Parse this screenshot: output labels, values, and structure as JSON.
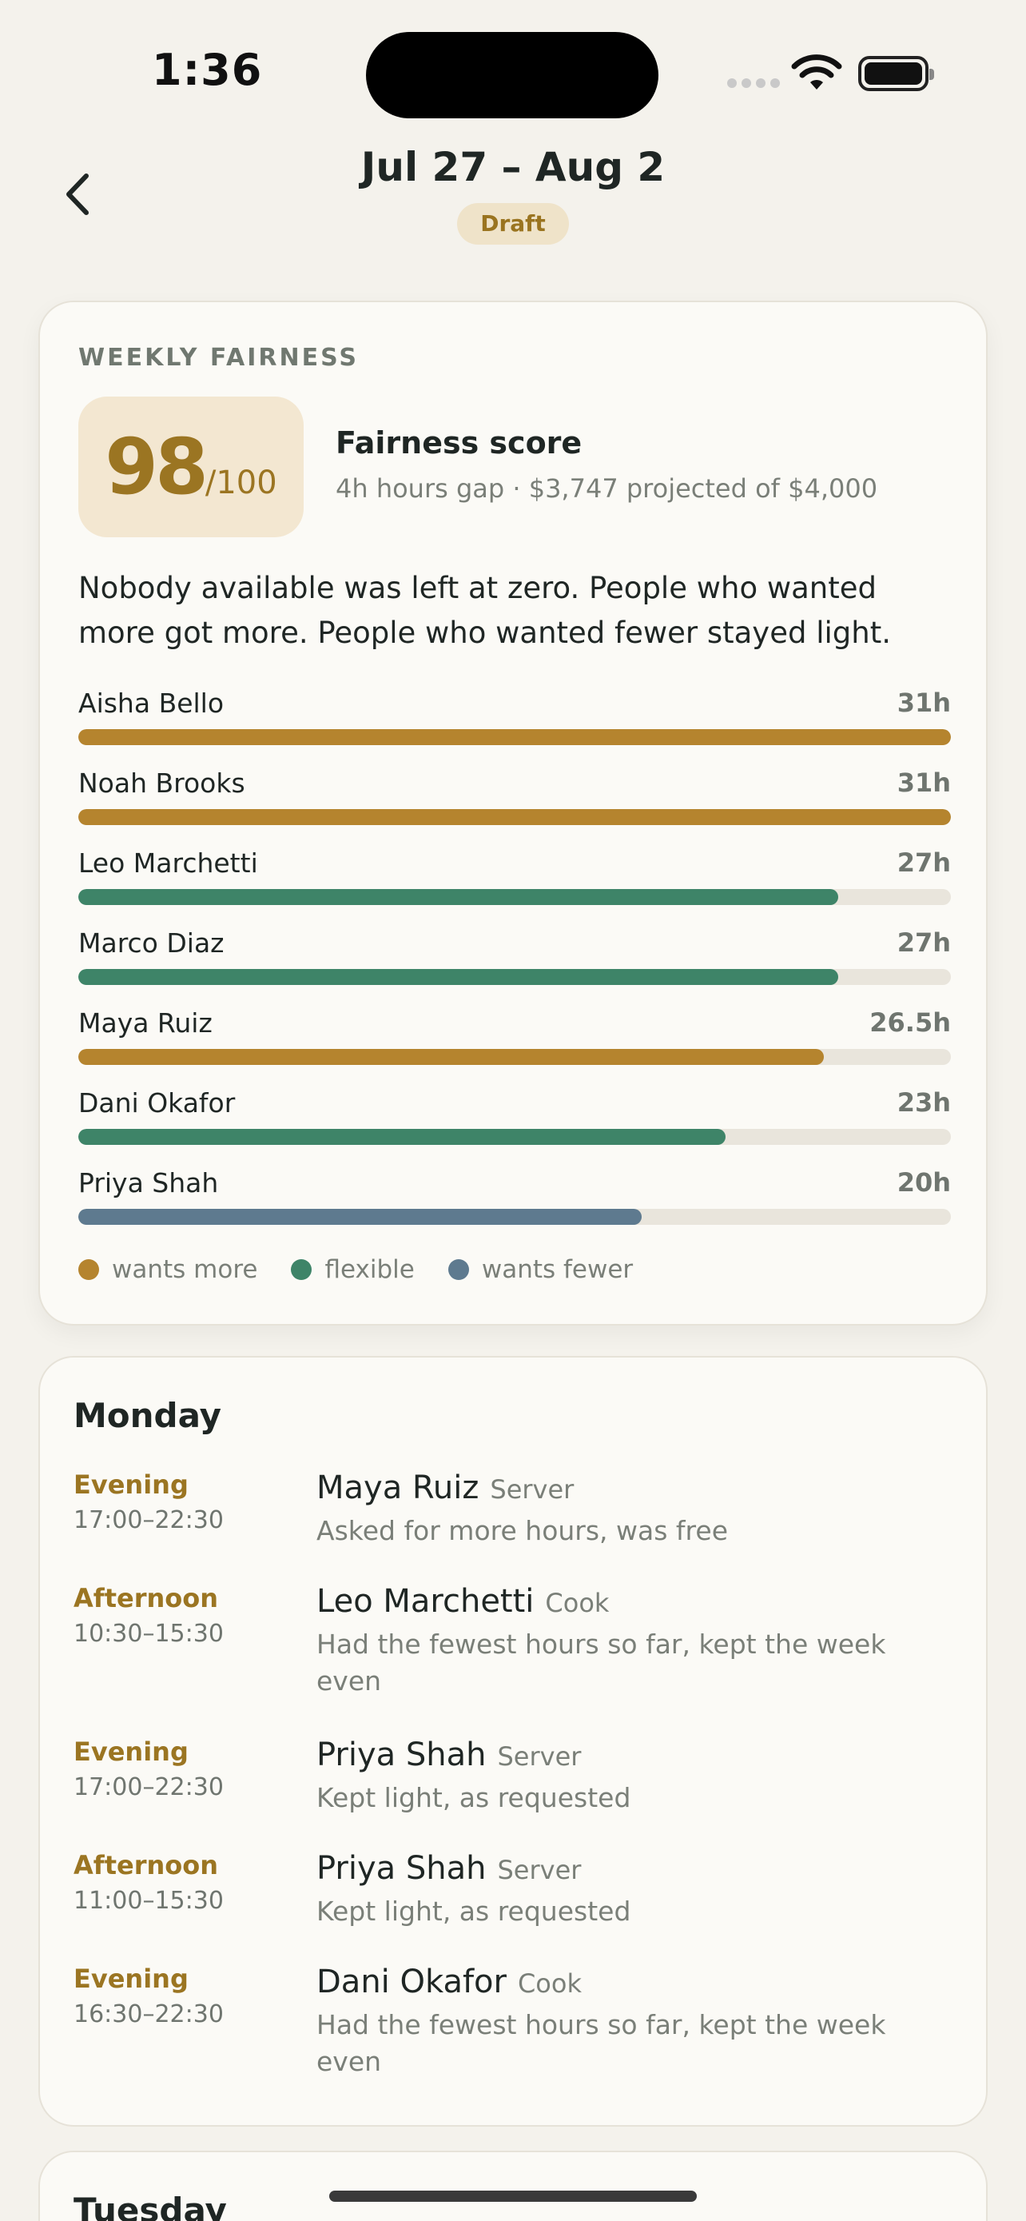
{
  "status_bar": {
    "time": "1:36"
  },
  "header": {
    "title": "Jul 27 – Aug 2",
    "badge": "Draft"
  },
  "fairness": {
    "section_label": "WEEKLY FAIRNESS",
    "score": "98",
    "score_denominator": "/100",
    "score_title": "Fairness score",
    "score_subtitle": "4h hours gap · $3,747 projected of $4,000",
    "summary": "Nobody available was left at zero. People who wanted more got more. People who wanted fewer stayed light.",
    "max_hours": 31,
    "people": [
      {
        "name": "Aisha Bello",
        "hours_label": "31h",
        "hours": 31,
        "preference": "wants_more"
      },
      {
        "name": "Noah Brooks",
        "hours_label": "31h",
        "hours": 31,
        "preference": "wants_more"
      },
      {
        "name": "Leo Marchetti",
        "hours_label": "27h",
        "hours": 27,
        "preference": "flexible"
      },
      {
        "name": "Marco Diaz",
        "hours_label": "27h",
        "hours": 27,
        "preference": "flexible"
      },
      {
        "name": "Maya Ruiz",
        "hours_label": "26.5h",
        "hours": 26.5,
        "preference": "wants_more"
      },
      {
        "name": "Dani Okafor",
        "hours_label": "23h",
        "hours": 23,
        "preference": "flexible"
      },
      {
        "name": "Priya Shah",
        "hours_label": "20h",
        "hours": 20,
        "preference": "wants_fewer"
      }
    ],
    "legend": [
      {
        "key": "wants_more",
        "label": "wants more",
        "color": "#b5842e"
      },
      {
        "key": "flexible",
        "label": "flexible",
        "color": "#3e8468"
      },
      {
        "key": "wants_fewer",
        "label": "wants fewer",
        "color": "#5e7a8f"
      }
    ]
  },
  "schedule": {
    "monday": {
      "title": "Monday",
      "shifts": [
        {
          "period": "Evening",
          "time": "17:00–22:30",
          "name": "Maya Ruiz",
          "role": "Server",
          "note": "Asked for more hours, was free"
        },
        {
          "period": "Afternoon",
          "time": "10:30–15:30",
          "name": "Leo Marchetti",
          "role": "Cook",
          "note": "Had the fewest hours so far, kept the week even"
        },
        {
          "period": "Evening",
          "time": "17:00–22:30",
          "name": "Priya Shah",
          "role": "Server",
          "note": "Kept light, as requested"
        },
        {
          "period": "Afternoon",
          "time": "11:00–15:30",
          "name": "Priya Shah",
          "role": "Server",
          "note": "Kept light, as requested"
        },
        {
          "period": "Evening",
          "time": "16:30–22:30",
          "name": "Dani Okafor",
          "role": "Cook",
          "note": "Had the fewest hours so far, kept the week even"
        }
      ]
    },
    "tuesday": {
      "title": "Tuesday"
    }
  }
}
